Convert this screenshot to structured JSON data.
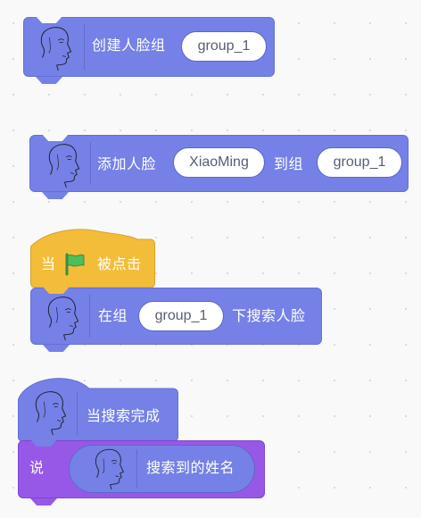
{
  "blocks": {
    "create_face_group": {
      "label": "创建人脸组",
      "group_value": "group_1"
    },
    "add_face": {
      "label_start": "添加人脸",
      "name_value": "XiaoMing",
      "label_mid": "到组",
      "group_value": "group_1"
    },
    "when_flag_clicked": {
      "label_when": "当",
      "label_clicked": "被点击"
    },
    "search_face": {
      "label_start": "在组",
      "group_value": "group_1",
      "label_end": "下搜索人脸"
    },
    "on_search_complete": {
      "label": "当搜索完成"
    },
    "say": {
      "label": "说",
      "reporter_label": "搜索到的姓名"
    }
  },
  "colors": {
    "face_extension": "#7581e6",
    "events": "#f4bd39",
    "looks": "#9758e7",
    "flag_green": "#4cbf56"
  },
  "icons": {
    "face": "face-profile-icon",
    "flag": "green-flag-icon"
  }
}
